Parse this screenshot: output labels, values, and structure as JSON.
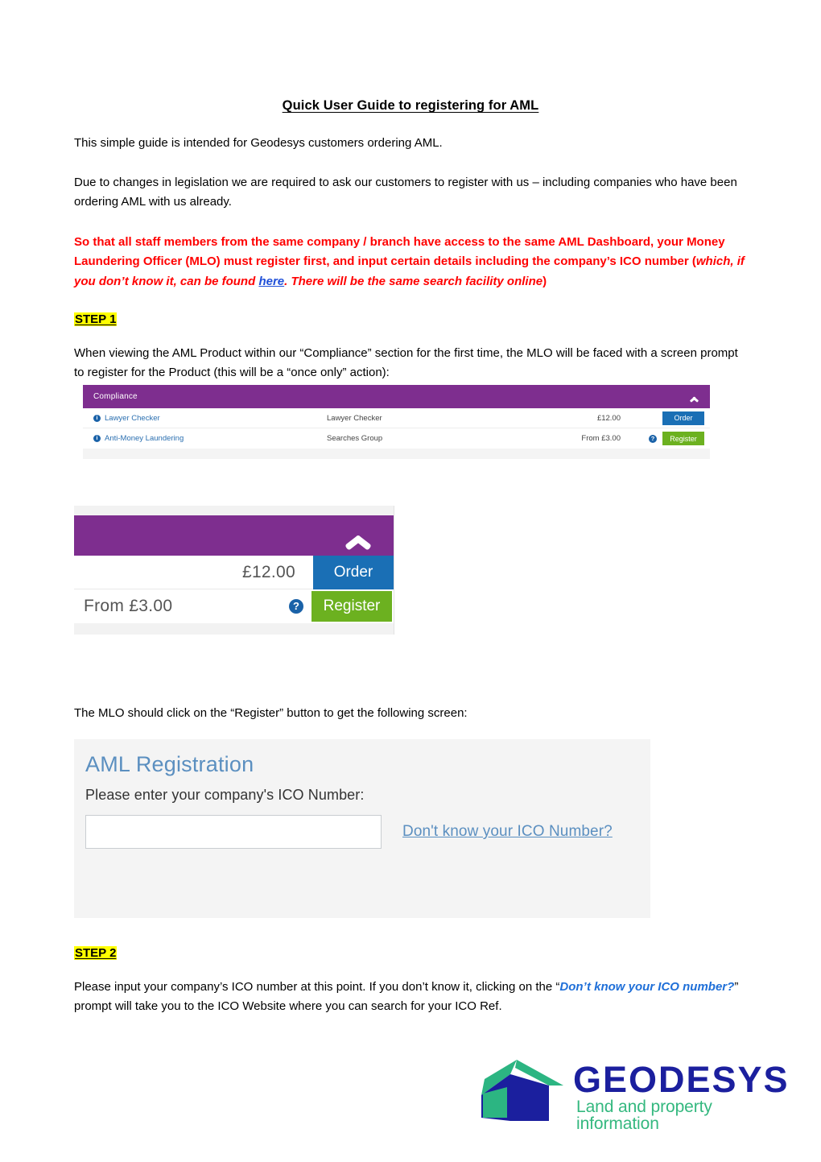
{
  "document": {
    "title": "Quick User Guide to registering for AML",
    "intro": "This simple guide is intended for Geodesys customers ordering AML.",
    "legislation": "Due to changes in legislation we are required to ask our customers to register with us – including companies who have been ordering AML with us already.",
    "notice": {
      "part1": "So that all staff members from the same company / branch have access to the same AML Dashboard, your Money Laundering Officer (MLO) must register first, and input certain details including the company’s ICO number (",
      "italic1": "which, if you don’t know it, can be found ",
      "link": "here",
      "italic2": ". There will be the same search facility online",
      "part2": ")"
    },
    "step1_label": "STEP 1",
    "step1_text": "When viewing the AML Product within our “Compliance” section for the first time, the MLO will be faced with a screen prompt to register for the Product (this will be a “once only” action):",
    "mlo_click_text": "The MLO should click on the “Register” button to get the following screen:",
    "step2_label": "STEP 2",
    "step2_part1": "Please input your company’s ICO number at this point. If you don’t know it, clicking on the “",
    "step2_emphasis": "Don’t know your ICO number?",
    "step2_part2": "” prompt will take you to the ICO Website where you can search for your ICO Ref."
  },
  "compliance_screenshot": {
    "header_title": "Compliance",
    "collapse_icon": "chevron-up-icon",
    "rows": [
      {
        "info_icon": "info-icon",
        "name": "Lawyer Checker",
        "group": "Lawyer Checker",
        "price": "£12.00",
        "help_icon": "",
        "action": "Order",
        "action_color": "#1a6fb5"
      },
      {
        "info_icon": "info-icon",
        "name": "Anti-Money Laundering",
        "group": "Searches Group",
        "price": "From £3.00",
        "help_icon": "question-icon",
        "action": "Register",
        "action_color": "#6cb120"
      }
    ]
  },
  "zoom_screenshot": {
    "collapse_icon": "chevron-up-icon",
    "rows": [
      {
        "price": "£12.00",
        "action": "Order",
        "has_help": false
      },
      {
        "price": "From £3.00",
        "action": "Register",
        "has_help": true
      }
    ]
  },
  "aml_registration_screenshot": {
    "title": "AML Registration",
    "label": "Please enter your company's ICO Number:",
    "input_value": "",
    "input_placeholder": "",
    "help_link": "Don't know your ICO Number?"
  },
  "logo": {
    "name": "GEODESYS",
    "tagline": "Land and property information",
    "house_green": "#2cb582",
    "house_blue": "#1b1f9e",
    "wordmark_color": "#1b1f9e",
    "tagline_color": "#34b87f"
  },
  "colors": {
    "purple": "#7e2e8f",
    "blue_button": "#1a6fb5",
    "green_button": "#6cb120",
    "red_text": "#ff0000",
    "highlight": "#ffff00",
    "link_blue": "#1f4fd8",
    "panel_blue": "#5b8fc0"
  }
}
